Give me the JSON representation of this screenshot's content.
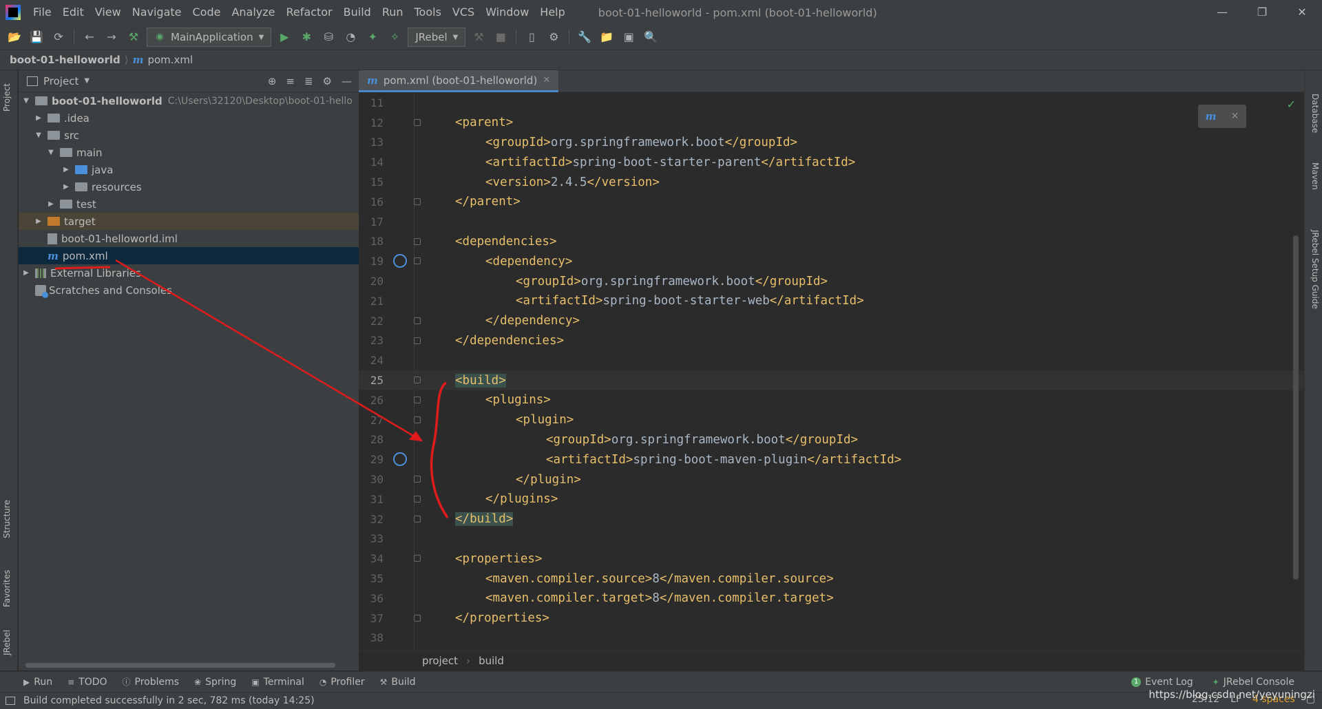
{
  "menubar": {
    "items": [
      "File",
      "Edit",
      "View",
      "Navigate",
      "Code",
      "Analyze",
      "Refactor",
      "Build",
      "Run",
      "Tools",
      "VCS",
      "Window",
      "Help"
    ],
    "window_title": "boot-01-helloworld - pom.xml (boot-01-helloworld)"
  },
  "toolbar": {
    "run_config": "MainApplication",
    "jrebel": "JRebel"
  },
  "breadcrumb": {
    "project": "boot-01-helloworld",
    "file": "pom.xml"
  },
  "left_strip": {
    "project": "Project",
    "structure": "Structure",
    "favorites": "Favorites",
    "jrebel": "JRebel"
  },
  "right_strip": {
    "database": "Database",
    "maven": "Maven",
    "jrebel_guide": "JRebel Setup Guide"
  },
  "project_panel": {
    "title": "Project",
    "root": "boot-01-helloworld",
    "root_path": "C:\\Users\\32120\\Desktop\\boot-01-hello",
    "idea": ".idea",
    "src": "src",
    "main": "main",
    "java": "java",
    "resources": "resources",
    "test": "test",
    "target": "target",
    "iml": "boot-01-helloworld.iml",
    "pom": "pom.xml",
    "external_libraries": "External Libraries",
    "scratches": "Scratches and Consoles"
  },
  "editor": {
    "tab": "pom.xml (boot-01-helloworld)",
    "lines": [
      {
        "n": "11",
        "indent": 0,
        "tag": "",
        "text": "",
        "close": ""
      },
      {
        "n": "12",
        "indent": 1,
        "tag": "<parent>",
        "text": "",
        "close": ""
      },
      {
        "n": "13",
        "indent": 2,
        "tag": "<groupId>",
        "text": "org.springframework.boot",
        "close": "</groupId>"
      },
      {
        "n": "14",
        "indent": 2,
        "tag": "<artifactId>",
        "text": "spring-boot-starter-parent",
        "close": "</artifactId>"
      },
      {
        "n": "15",
        "indent": 2,
        "tag": "<version>",
        "text": "2.4.5",
        "close": "</version>"
      },
      {
        "n": "16",
        "indent": 1,
        "tag": "</parent>",
        "text": "",
        "close": ""
      },
      {
        "n": "17",
        "indent": 0,
        "tag": "",
        "text": "",
        "close": ""
      },
      {
        "n": "18",
        "indent": 1,
        "tag": "<dependencies>",
        "text": "",
        "close": ""
      },
      {
        "n": "19",
        "indent": 2,
        "tag": "<dependency>",
        "text": "",
        "close": ""
      },
      {
        "n": "20",
        "indent": 3,
        "tag": "<groupId>",
        "text": "org.springframework.boot",
        "close": "</groupId>"
      },
      {
        "n": "21",
        "indent": 3,
        "tag": "<artifactId>",
        "text": "spring-boot-starter-web",
        "close": "</artifactId>"
      },
      {
        "n": "22",
        "indent": 2,
        "tag": "</dependency>",
        "text": "",
        "close": ""
      },
      {
        "n": "23",
        "indent": 1,
        "tag": "</dependencies>",
        "text": "",
        "close": ""
      },
      {
        "n": "24",
        "indent": 0,
        "tag": "",
        "text": "",
        "close": ""
      },
      {
        "n": "25",
        "indent": 1,
        "tag": "<build>",
        "text": "",
        "close": ""
      },
      {
        "n": "26",
        "indent": 2,
        "tag": "<plugins>",
        "text": "",
        "close": ""
      },
      {
        "n": "27",
        "indent": 3,
        "tag": "<plugin>",
        "text": "",
        "close": ""
      },
      {
        "n": "28",
        "indent": 4,
        "tag": "<groupId>",
        "text": "org.springframework.boot",
        "close": "</groupId>"
      },
      {
        "n": "29",
        "indent": 4,
        "tag": "<artifactId>",
        "text": "spring-boot-maven-plugin",
        "close": "</artifactId>"
      },
      {
        "n": "30",
        "indent": 3,
        "tag": "</plugin>",
        "text": "",
        "close": ""
      },
      {
        "n": "31",
        "indent": 2,
        "tag": "</plugins>",
        "text": "",
        "close": ""
      },
      {
        "n": "32",
        "indent": 1,
        "tag": "</build>",
        "text": "",
        "close": ""
      },
      {
        "n": "33",
        "indent": 0,
        "tag": "",
        "text": "",
        "close": ""
      },
      {
        "n": "34",
        "indent": 1,
        "tag": "<properties>",
        "text": "",
        "close": ""
      },
      {
        "n": "35",
        "indent": 2,
        "tag": "<maven.compiler.source>",
        "text": "8",
        "close": "</maven.compiler.source>"
      },
      {
        "n": "36",
        "indent": 2,
        "tag": "<maven.compiler.target>",
        "text": "8",
        "close": "</maven.compiler.target>"
      },
      {
        "n": "37",
        "indent": 1,
        "tag": "</properties>",
        "text": "",
        "close": ""
      },
      {
        "n": "38",
        "indent": 0,
        "tag": "",
        "text": "",
        "close": ""
      }
    ],
    "breadcrumb_project": "project",
    "breadcrumb_build": "build"
  },
  "bottom_tools": {
    "run": "Run",
    "todo": "TODO",
    "problems": "Problems",
    "spring": "Spring",
    "terminal": "Terminal",
    "profiler": "Profiler",
    "build": "Build",
    "event_log": "Event Log",
    "event_count": "1",
    "jrebel_console": "JRebel Console"
  },
  "status": {
    "message": "Build completed successfully in 2 sec, 782 ms (today 14:25)",
    "position": "25:12",
    "line_sep": "LF",
    "indent": "4 spaces",
    "watermark": "https://blog.csdn.net/yeyuningzi"
  },
  "colors": {
    "tag": "#e8bf6a",
    "text": "#a9b7c6",
    "annotation": "#e01b1b"
  }
}
